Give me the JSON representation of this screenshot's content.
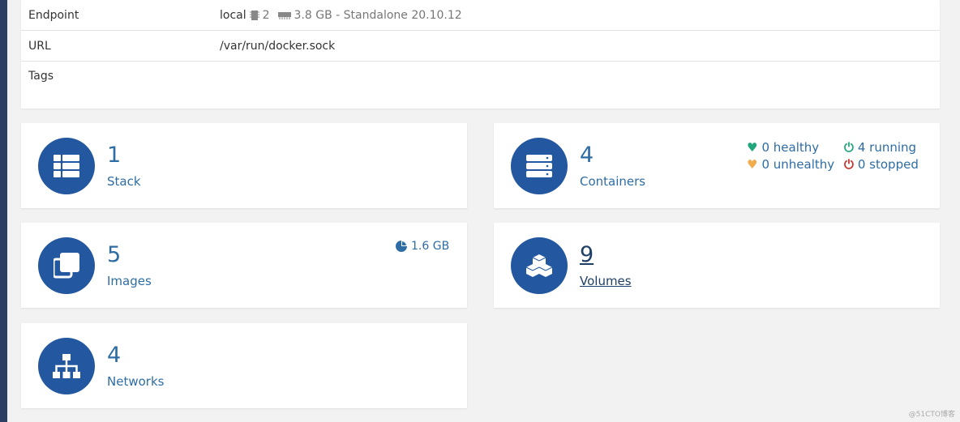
{
  "endpoint": {
    "rows": [
      {
        "key": "Endpoint",
        "name": "local",
        "cpu": "2",
        "memory": "3.8 GB - Standalone 20.10.12"
      },
      {
        "key": "URL",
        "value": "/var/run/docker.sock"
      },
      {
        "key": "Tags",
        "value": ""
      }
    ]
  },
  "cards": {
    "stack": {
      "count": "1",
      "label": "Stack"
    },
    "containers": {
      "count": "4",
      "label": "Containers",
      "healthy": "0 healthy",
      "unhealthy": "0 unhealthy",
      "running": "4 running",
      "stopped": "0 stopped"
    },
    "images": {
      "count": "5",
      "label": "Images",
      "size": "1.6 GB"
    },
    "volumes": {
      "count": "9",
      "label": "Volumes"
    },
    "networks": {
      "count": "4",
      "label": "Networks"
    }
  },
  "colors": {
    "accent": "#23579f",
    "healthy": "#1fa67a",
    "unhealthy": "#f0ad4e",
    "stopped": "#c9302c"
  },
  "watermark": "@51CTO博客"
}
